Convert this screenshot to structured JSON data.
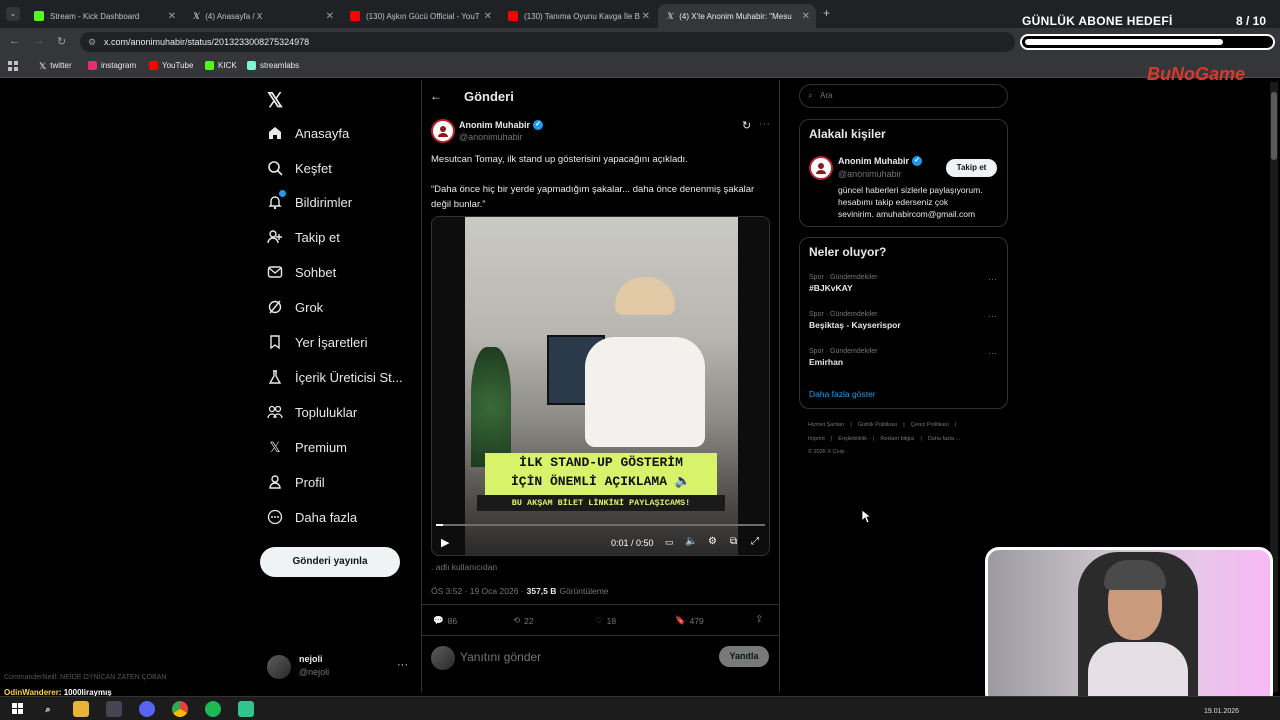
{
  "browser": {
    "tabs": [
      {
        "label": "Stream - Kick Dashboard",
        "icon": "kick-icon",
        "color": "#53fc18"
      },
      {
        "label": "(4) Anasayfa / X",
        "icon": "x-icon",
        "color": "#ffffff"
      },
      {
        "label": "(130) Aşkın Gücü Official - YouT",
        "icon": "youtube-icon",
        "color": "#ff0000"
      },
      {
        "label": "(130) Tanıma Oyunu Kavga İle B",
        "icon": "youtube-icon",
        "color": "#ff0000"
      },
      {
        "label": "(4) X'te Anonim Muhabir: \"Mesu",
        "icon": "x-icon",
        "color": "#ffffff"
      }
    ],
    "url": "x.com/anonimuhabir/status/2013233008275324978",
    "bookmarks": [
      {
        "label": "twitter",
        "icon": "x-icon",
        "color": "#ffffff"
      },
      {
        "label": "instagram",
        "icon": "instagram-icon",
        "color": "#e1306c"
      },
      {
        "label": "YouTube",
        "icon": "youtube-icon",
        "color": "#ff0000"
      },
      {
        "label": "KICK",
        "icon": "kick-icon",
        "color": "#53fc18"
      },
      {
        "label": "streamlabs",
        "icon": "streamlabs-icon",
        "color": "#80f5d2"
      }
    ]
  },
  "nav": {
    "items": [
      {
        "label": "Anasayfa",
        "icon": "home-icon"
      },
      {
        "label": "Keşfet",
        "icon": "search-icon"
      },
      {
        "label": "Bildirimler",
        "icon": "bell-icon"
      },
      {
        "label": "Takip et",
        "icon": "follow-icon"
      },
      {
        "label": "Sohbet",
        "icon": "mail-icon"
      },
      {
        "label": "Grok",
        "icon": "grok-icon"
      },
      {
        "label": "Yer İşaretleri",
        "icon": "bookmark-icon"
      },
      {
        "label": "İçerik Üreticisi St...",
        "icon": "flask-icon"
      },
      {
        "label": "Topluluklar",
        "icon": "communities-icon"
      },
      {
        "label": "Premium",
        "icon": "x-icon"
      },
      {
        "label": "Profil",
        "icon": "person-icon"
      },
      {
        "label": "Daha fazla",
        "icon": "more-circle-icon"
      }
    ],
    "post_button": "Gönderi yayınla",
    "user": {
      "name": "nejoli",
      "handle": "@nejoli"
    }
  },
  "post": {
    "header": "Gönderi",
    "author_name": "Anonim Muhabir",
    "author_handle": "@anonimuhabir",
    "text1": "Mesutcan Tomay, ilk stand up gösterisini yapacağını açıkladı.",
    "text2": "“Daha önce hiç bir yerde yapmadığım şakalar... daha önce denenmiş şakalar değil bunlar.”",
    "video": {
      "caption_line1": "İLK STAND-UP GÖSTERİM",
      "caption_line2": "İÇİN ÖNEMLİ AÇIKLAMA 🔈",
      "caption_line3": "BU AKŞAM BİLET LİNKİNİ PAYLAŞICAMS!",
      "time": "0:01 / 0:50",
      "progress": 0.02
    },
    "username_note": ". adlı kullanıcıdan",
    "timestamp": "ÖS 3:52 · 19 Oca 2026 ·",
    "views_count": "357,5 B",
    "views_label": "Görüntüleme",
    "stats": {
      "replies": "86",
      "reposts": "22",
      "likes": "18",
      "bookmarks": "479"
    },
    "reply_placeholder": "Yanıtını gönder",
    "reply_button": "Yanıtla"
  },
  "sidebar": {
    "search_placeholder": "Ara",
    "related_title": "Alakalı kişiler",
    "related": {
      "name": "Anonim Muhabir",
      "handle": "@anonimuhabir",
      "follow": "Takip et",
      "bio1": "güncel haberleri sizlerle paylaşıyorum.",
      "bio2": "hesabımı takip ederseniz çok",
      "bio3": "sevinirim. amuhabircom@gmail.com"
    },
    "trends_title": "Neler oluyor?",
    "trends": [
      {
        "context": "Spor · Gündemdekiler",
        "name": "#BJKvKAY"
      },
      {
        "context": "Spor · Gündemdekiler",
        "name": "Beşiktaş - Kayserispor"
      },
      {
        "context": "Spor · Gündemdekiler",
        "name": "Emirhan"
      }
    ],
    "show_more": "Daha fazla göster",
    "footer": {
      "row1": [
        "Hizmet Şartları",
        "Gizlilik Politikası",
        "Çerez Politikası"
      ],
      "row2": [
        "Imprint",
        "Erişilebilirlik",
        "Reklam bilgisi",
        "Daha fazla ..."
      ],
      "copyright": "© 2026 X Corp."
    }
  },
  "overlay": {
    "goal_title": "GÜNLÜK ABONE HEDEFİ",
    "goal_count": "8 / 10",
    "goal_progress": 0.8,
    "brand": "BuNoGame",
    "chat1_user": "OdinWanderer",
    "chat1_msg": ": 1000liraymış",
    "chat0_user": "CommanderNeill",
    "chat0_msg": ": NEİDE OYNİCAN ZATEN ÇOBAN"
  },
  "taskbar": {
    "date": "19.01.2026"
  }
}
